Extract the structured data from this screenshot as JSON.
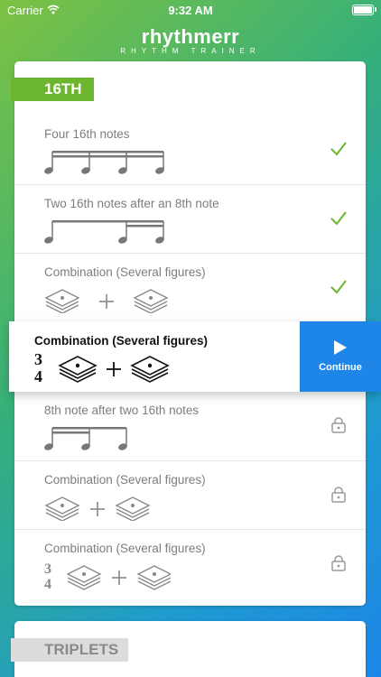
{
  "status_bar": {
    "carrier": "Carrier",
    "time": "9:32 AM"
  },
  "logo": {
    "name": "rhythmerr",
    "subtitle": "RHYTHM TRAINER"
  },
  "sections": [
    {
      "label": "16TH",
      "items": [
        {
          "title": "Four 16th notes",
          "notation": "four-16th-notes",
          "status": "completed",
          "status_icon": "check-icon"
        },
        {
          "title": "Two 16th notes after an 8th note",
          "notation": "8th-two-16th",
          "status": "completed",
          "status_icon": "check-icon"
        },
        {
          "title": "Combination (Several figures)",
          "notation": "combination",
          "status": "completed",
          "status_icon": "check-icon"
        },
        {
          "title": "Combination (Several figures)",
          "notation": "combination-3-4",
          "status": "current",
          "time_signature": "3/4"
        },
        {
          "title": "8th note after two 16th notes",
          "notation": "two-16th-8th",
          "status": "locked",
          "status_icon": "lock-icon"
        },
        {
          "title": "Combination (Several figures)",
          "notation": "combination",
          "status": "locked",
          "status_icon": "lock-icon"
        },
        {
          "title": "Combination (Several figures)",
          "notation": "combination-3-4",
          "status": "locked",
          "status_icon": "lock-icon",
          "time_signature": "3/4"
        }
      ]
    },
    {
      "label": "TRIPLETS"
    }
  ],
  "continue_button": {
    "label": "Continue",
    "icon": "play-icon"
  },
  "colors": {
    "green_accent": "#6cb52f",
    "blue_accent": "#1e86e8",
    "check": "#6cb52f",
    "lock": "#9a9a9a"
  }
}
